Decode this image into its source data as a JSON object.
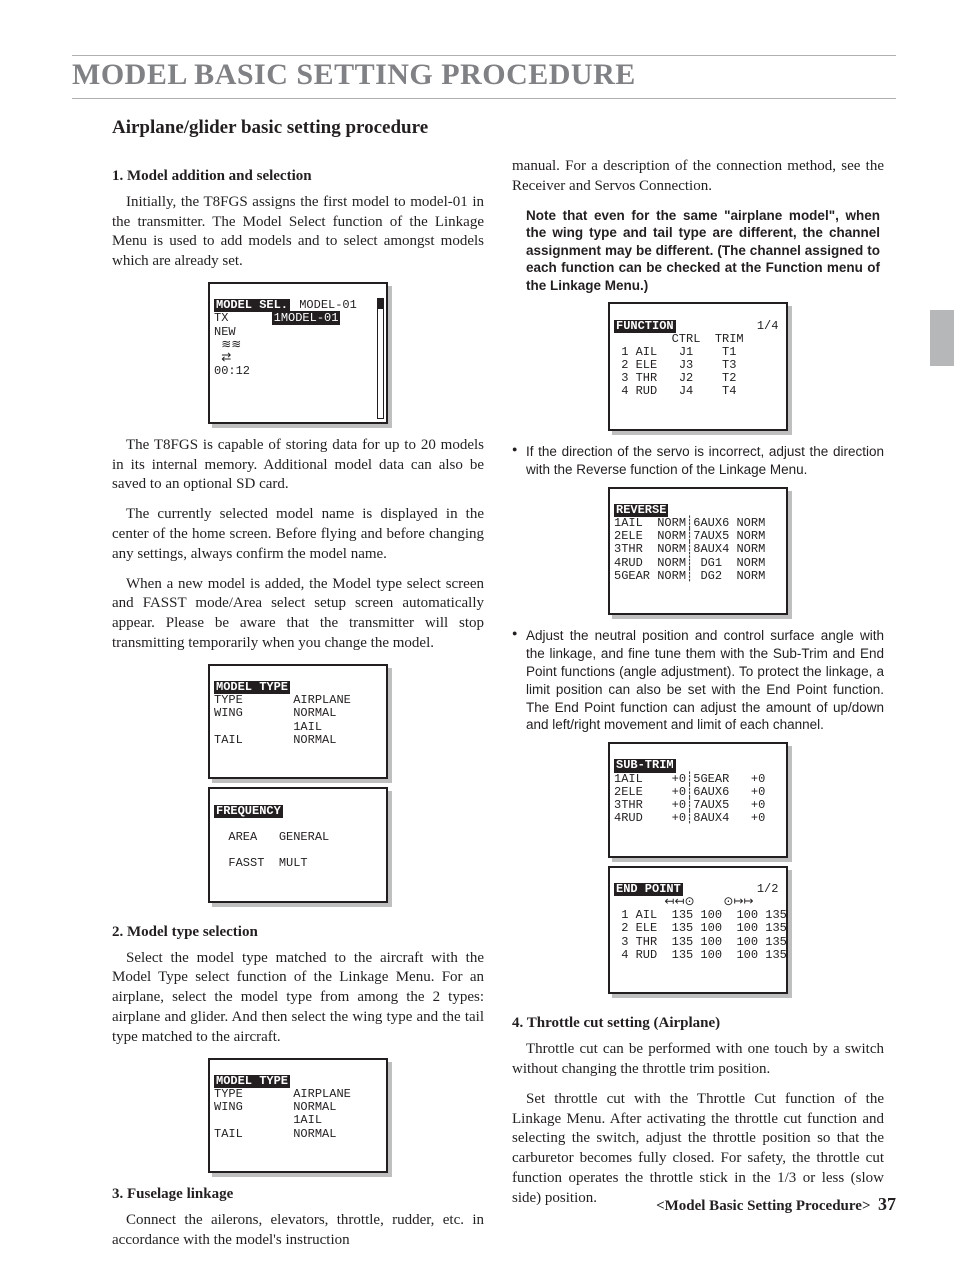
{
  "page": {
    "title": "MODEL BASIC SETTING PROCEDURE",
    "subtitle": "Airplane/glider basic setting procedure",
    "footer_label": "<Model Basic Setting Procedure>",
    "page_number": "37"
  },
  "left": {
    "h1": "1. Model addition and selection",
    "p1": "Initially, the T8FGS assigns the first model to model-01 in the transmitter. The Model Select function of the Linkage Menu is used to add models and to select amongst models which are already set.",
    "p2": "The T8FGS is capable of storing data for up to 20 models  in its internal memory. Additional model data can also be saved to an optional SD card.",
    "p3": "The currently selected model name is displayed in the center of the home screen. Before flying and before changing any settings, always confirm the model name.",
    "p4": "When a new model is added, the Model type select screen and FASST mode/Area select setup screen automatically appear. Please be  aware that the transmitter will stop transmitting temporarily when you change the model.",
    "h2": "2. Model type selection",
    "p5": "Select the model type matched to the aircraft with the Model Type select function of the Linkage Menu. For an airplane, select the model type from among the 2 types: airplane and glider. And then select the wing type and the tail type matched to the aircraft.",
    "h3": "3. Fuselage linkage",
    "p6": "Connect the ailerons, elevators, throttle, rudder, etc. in accordance with the model's instruction"
  },
  "right": {
    "p1": "manual. For a description of the connection method, see the Receiver and Servos Connection.",
    "note": "Note that even for the same \"airplane model\", when the wing type and tail type are different, the channel assignment may be different. (The channel assigned to each function can be checked at the Function menu of the Linkage Menu.)",
    "b1": "If the direction of the servo is incorrect, adjust the direction with the Reverse function of the Linkage Menu.",
    "b2": "Adjust the neutral position and control surface angle with the linkage, and fine tune them with the Sub-Trim and End Point functions (angle adjustment). To protect the linkage, a limit position can also be set with the End Point function. The End Point function can adjust the amount of up/down and left/right movement and limit of each channel.",
    "h4": "4. Throttle cut setting (Airplane)",
    "p7": "Throttle cut can be performed with one touch by a switch without changing the throttle trim position.",
    "p8": "Set throttle cut with the Throttle Cut function of the Linkage Menu. After activating the throttle cut function and selecting the switch, adjust the throttle position so that the carburetor becomes fully closed. For safety, the throttle cut function operates the throttle stick in the 1/3 or less (slow side) position."
  },
  "lcd": {
    "model_sel": {
      "header": "MODEL SEL.",
      "title_right": "MODEL-01",
      "rows": [
        "TX",
        "NEW"
      ],
      "selected": "1MODEL-01",
      "time": "00:12"
    },
    "model_type": {
      "header": "MODEL TYPE",
      "rows": [
        [
          "TYPE",
          "AIRPLANE"
        ],
        [
          "WING",
          "NORMAL"
        ],
        [
          "",
          "1AIL"
        ],
        [
          "TAIL",
          "NORMAL"
        ]
      ]
    },
    "frequency": {
      "header": "FREQUENCY",
      "rows": [
        [
          "AREA",
          "GENERAL"
        ],
        [
          "FASST",
          "MULT"
        ]
      ]
    },
    "function": {
      "header": "FUNCTION",
      "page": "1/4",
      "cols": [
        "",
        "CTRL",
        "TRIM"
      ],
      "rows": [
        [
          "1 AIL",
          "J1",
          "T1"
        ],
        [
          "2 ELE",
          "J3",
          "T3"
        ],
        [
          "3 THR",
          "J2",
          "T2"
        ],
        [
          "4 RUD",
          "J4",
          "T4"
        ]
      ]
    },
    "reverse": {
      "header": "REVERSE",
      "rows": [
        [
          "1AIL",
          "NORM",
          "6AUX6",
          "NORM"
        ],
        [
          "2ELE",
          "NORM",
          "7AUX5",
          "NORM"
        ],
        [
          "3THR",
          "NORM",
          "8AUX4",
          "NORM"
        ],
        [
          "4RUD",
          "NORM",
          "DG1",
          "NORM"
        ],
        [
          "5GEAR",
          "NORM",
          "DG2",
          "NORM"
        ]
      ]
    },
    "subtrim": {
      "header": "SUB-TRIM",
      "rows": [
        [
          "1AIL",
          "+0",
          "5GEAR",
          "+0"
        ],
        [
          "2ELE",
          "+0",
          "6AUX6",
          "+0"
        ],
        [
          "3THR",
          "+0",
          "7AUX5",
          "+0"
        ],
        [
          "4RUD",
          "+0",
          "8AUX4",
          "+0"
        ]
      ]
    },
    "endpoint": {
      "header": "END POINT",
      "page": "1/2",
      "arrows": "↤↤⊙    ⊙↦↦",
      "rows": [
        [
          "1 AIL",
          "135 100",
          "100 135"
        ],
        [
          "2 ELE",
          "135 100",
          "100 135"
        ],
        [
          "3 THR",
          "135 100",
          "100 135"
        ],
        [
          "4 RUD",
          "135 100",
          "100 135"
        ]
      ]
    }
  }
}
